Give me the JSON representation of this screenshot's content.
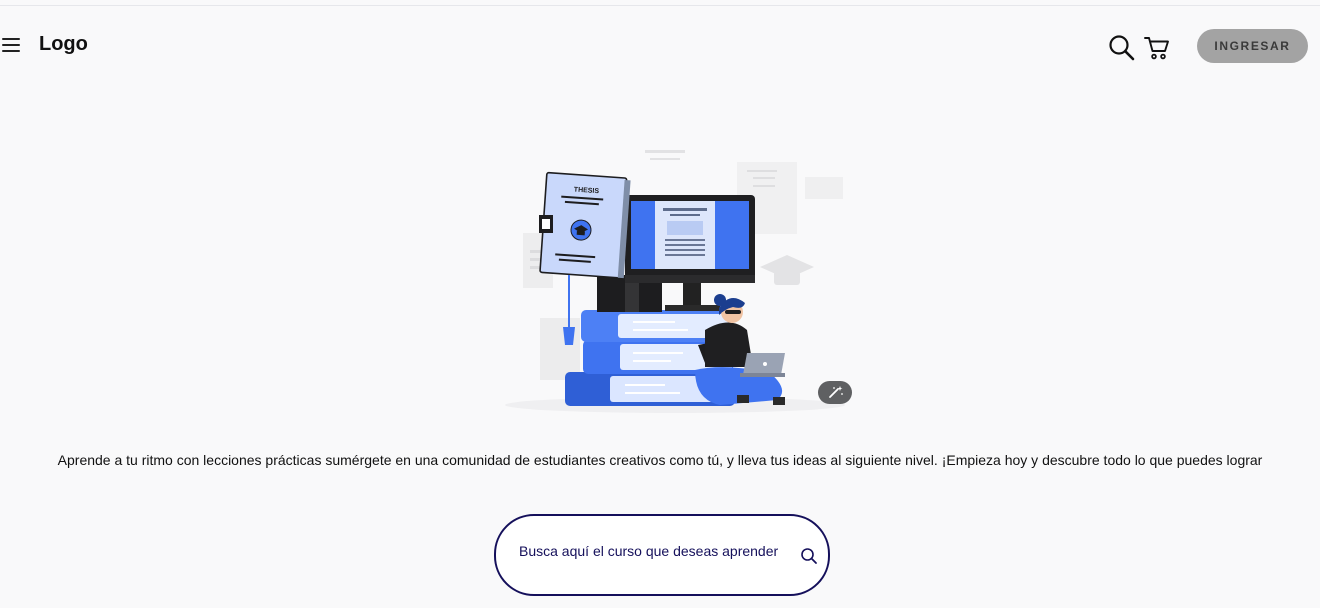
{
  "header": {
    "logo": "Logo",
    "menu_icon": "hamburger-menu-icon",
    "search_icon": "search-icon",
    "cart_icon": "cart-icon",
    "login_label": "INGRESAR"
  },
  "hero": {
    "illustration": "student-thesis-books-illustration",
    "illustration_book_label": "THESIS",
    "magic_icon": "magic-wand-icon"
  },
  "content": {
    "tagline": "Aprende a tu ritmo con lecciones prácticas  sumérgete en una comunidad de estudiantes creativos como tú, y lleva tus ideas al siguiente nivel. ¡Empieza hoy y descubre todo lo que puedes lograr"
  },
  "search": {
    "placeholder": "Busca aquí el curso que deseas aprender",
    "icon": "search-icon"
  },
  "colors": {
    "background": "#f9f9fa",
    "accent_blue": "#3f73f0",
    "search_border": "#15105b",
    "button_gray": "#a3a3a3"
  }
}
